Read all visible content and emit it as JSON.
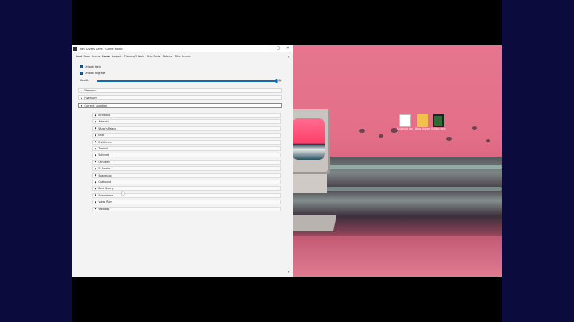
{
  "window": {
    "title": "Hell Divers Save / Game Editor",
    "controls": {
      "minimize": "—",
      "maximize": "▢",
      "close": "✕"
    }
  },
  "menu": [
    {
      "label": "Load Save",
      "active": false
    },
    {
      "label": "Icons",
      "active": false
    },
    {
      "label": "Hero",
      "active": true
    },
    {
      "label": "Logout",
      "active": false
    },
    {
      "label": "Planets/Tribals",
      "active": false
    },
    {
      "label": "Ship Parts",
      "active": false
    },
    {
      "label": "Tokens",
      "active": false
    },
    {
      "label": "Title Screen",
      "active": false
    }
  ],
  "options": {
    "unlock_help": "Unlock Help",
    "unlock_migrate": "Unlock Migrate"
  },
  "health": {
    "label": "Health",
    "value": "98",
    "fraction": 0.98
  },
  "sections": {
    "weapons": "Weapons",
    "inventory": "Inventory",
    "current_location": "Current Location"
  },
  "locations": [
    "Bird Bass",
    "Asteroid",
    "Wizer's Palace",
    "Ickor",
    "Bivfaltrom",
    "Tarefall",
    "Splinned",
    "Cerulean",
    "St Ainshe",
    "Spaceship",
    "Outbound",
    "Dark Quarry",
    "Spacedome",
    "Video Rum",
    "Walkway"
  ],
  "desktop_icons": [
    {
      "id": "file",
      "label": "Untitled document"
    },
    {
      "id": "folder",
      "label": "New folder"
    },
    {
      "id": "exe",
      "label": "Editor.exe"
    }
  ],
  "scroll": {
    "up": "▲",
    "down": "▼"
  },
  "glyphs": {
    "collapsed": "▶",
    "expanded": "▼"
  },
  "colors": {
    "accent": "#0f6cbd",
    "wallpaper_pink": "#e5768d",
    "letterbox": "#0b0b3d"
  }
}
